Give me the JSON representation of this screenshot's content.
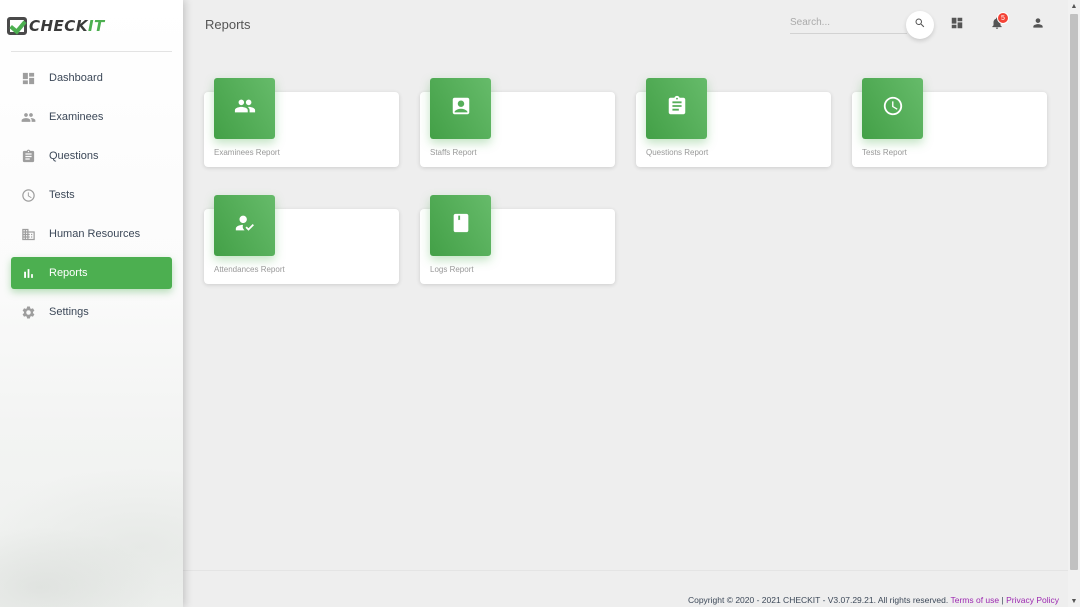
{
  "sidebar": {
    "logo": {
      "text_main": "CHECK",
      "text_accent": "IT"
    },
    "items": [
      {
        "label": "Dashboard",
        "icon": "dashboard-icon",
        "active": false
      },
      {
        "label": "Examinees",
        "icon": "people-icon",
        "active": false
      },
      {
        "label": "Questions",
        "icon": "clipboard-icon",
        "active": false
      },
      {
        "label": "Tests",
        "icon": "clock-icon",
        "active": false
      },
      {
        "label": "Human Resources",
        "icon": "building-icon",
        "active": false
      },
      {
        "label": "Reports",
        "icon": "bar-chart-icon",
        "active": true
      },
      {
        "label": "Settings",
        "icon": "gear-icon",
        "active": false
      }
    ]
  },
  "header": {
    "title": "Reports",
    "search": {
      "placeholder": "Search...",
      "value": ""
    },
    "notifications_count": "5"
  },
  "reports": [
    {
      "label": "Examinees Report",
      "icon": "people-icon"
    },
    {
      "label": "Staffs Report",
      "icon": "contact-card-icon"
    },
    {
      "label": "Questions Report",
      "icon": "clipboard-icon"
    },
    {
      "label": "Tests Report",
      "icon": "clock-icon"
    },
    {
      "label": "Attendances Report",
      "icon": "person-check-icon"
    },
    {
      "label": "Logs Report",
      "icon": "book-icon"
    }
  ],
  "footer": {
    "copyright": "Copyright © 2020 - 2021 CHECKIT - V3.07.29.21. All rights reserved.",
    "terms": "Terms of use",
    "separator": "|",
    "privacy": "Privacy Policy"
  },
  "colors": {
    "accent": "#4caf50",
    "badge": "#f44336",
    "link": "#9c27b0"
  }
}
